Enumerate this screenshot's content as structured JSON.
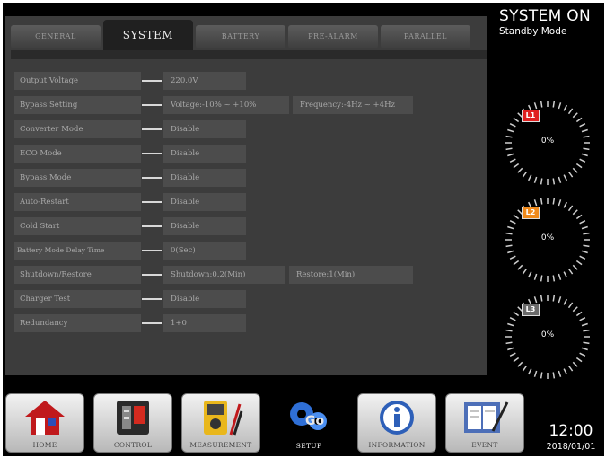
{
  "tabs": [
    {
      "label": "GENERAL"
    },
    {
      "label": "SYSTEM"
    },
    {
      "label": "BATTERY"
    },
    {
      "label": "PRE-ALARM"
    },
    {
      "label": "PARALLEL"
    }
  ],
  "settings": [
    {
      "label": "Output Voltage",
      "values": [
        "220.0V"
      ]
    },
    {
      "label": "Bypass Setting",
      "values": [
        "Voltage:-10% ~ +10%",
        "Frequency:-4Hz ~ +4Hz"
      ]
    },
    {
      "label": "Converter Mode",
      "values": [
        "Disable"
      ]
    },
    {
      "label": "ECO Mode",
      "values": [
        "Disable"
      ]
    },
    {
      "label": "Bypass Mode",
      "values": [
        "Disable"
      ]
    },
    {
      "label": "Auto-Restart",
      "values": [
        "Disable"
      ]
    },
    {
      "label": "Cold Start",
      "values": [
        "Disable"
      ]
    },
    {
      "label": "Battery Mode Delay Time",
      "values": [
        "0(Sec)"
      ]
    },
    {
      "label": "Shutdown/Restore",
      "values": [
        "Shutdown:0.2(Min)",
        "Restore:1(Min)"
      ]
    },
    {
      "label": "Charger Test",
      "values": [
        "Disable"
      ]
    },
    {
      "label": "Redundancy",
      "values": [
        "1+0"
      ]
    }
  ],
  "status": {
    "title": "SYSTEM ON",
    "mode": "Standby Mode"
  },
  "phases": [
    {
      "badge": "L1",
      "percent": "0%",
      "color": "#e02020"
    },
    {
      "badge": "L2",
      "percent": "0%",
      "color": "#f08a1c"
    },
    {
      "badge": "L3",
      "percent": "0%",
      "color": "#6a6a6a"
    }
  ],
  "dock": [
    {
      "label": "HOME",
      "icon": "home-icon"
    },
    {
      "label": "CONTROL",
      "icon": "control-icon"
    },
    {
      "label": "MEASUREMENT",
      "icon": "multimeter-icon"
    },
    {
      "label": "SETUP",
      "icon": "gears-icon"
    },
    {
      "label": "INFORMATION",
      "icon": "info-icon"
    },
    {
      "label": "EVENT",
      "icon": "event-log-icon"
    }
  ],
  "clock": {
    "time": "12:00",
    "date": "2018/01/01"
  }
}
